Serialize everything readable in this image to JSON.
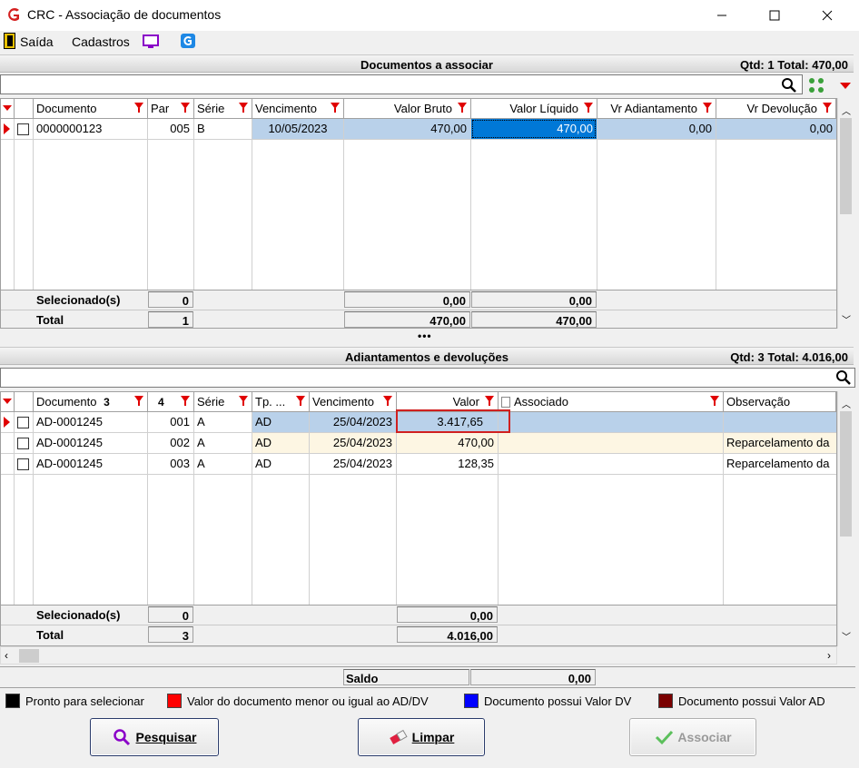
{
  "window": {
    "title": "CRC - Associação de documentos"
  },
  "menu": {
    "saida": "Saída",
    "cadastros": "Cadastros"
  },
  "top_section": {
    "title": "Documentos a associar",
    "summary": "Qtd: 1 Total: 470,00",
    "columns": [
      "Documento",
      "Par",
      "Série",
      "Vencimento",
      "Valor Bruto",
      "Valor Líquido",
      "Vr Adiantamento",
      "Vr Devolução"
    ],
    "rows": [
      {
        "documento": "0000000123",
        "par": "005",
        "serie": "B",
        "vencimento": "10/05/2023",
        "valor_bruto": "470,00",
        "valor_liquido": "470,00",
        "vr_adiantamento": "0,00",
        "vr_devolucao": "0,00"
      }
    ],
    "selecionados_label": "Selecionado(s)",
    "selecionados_count": "0",
    "selecionados_bruto": "0,00",
    "selecionados_liquido": "0,00",
    "total_label": "Total",
    "total_count": "1",
    "total_bruto": "470,00",
    "total_liquido": "470,00"
  },
  "splitter": "•••",
  "bottom_section": {
    "title": "Adiantamentos e devoluções",
    "summary": "Qtd: 3 Total: 4.016,00",
    "columns": [
      "Documento",
      "Par",
      "Série",
      "Tp. ...",
      "Vencimento",
      "Valor",
      "Associado",
      "Observação"
    ],
    "sort_documento": "3",
    "sort_par": "4",
    "rows": [
      {
        "documento": "AD-0001245",
        "par": "001",
        "serie": "A",
        "tp": "AD",
        "vencimento": "25/04/2023",
        "valor": "3.417,65",
        "associado": "",
        "observacao": ""
      },
      {
        "documento": "AD-0001245",
        "par": "002",
        "serie": "A",
        "tp": "AD",
        "vencimento": "25/04/2023",
        "valor": "470,00",
        "associado": "",
        "observacao": "Reparcelamento da"
      },
      {
        "documento": "AD-0001245",
        "par": "003",
        "serie": "A",
        "tp": "AD",
        "vencimento": "25/04/2023",
        "valor": "128,35",
        "associado": "",
        "observacao": "Reparcelamento da"
      }
    ],
    "selecionados_label": "Selecionado(s)",
    "selecionados_count": "0",
    "selecionados_valor": "0,00",
    "total_label": "Total",
    "total_count": "3",
    "total_valor": "4.016,00"
  },
  "saldo": {
    "label": "Saldo",
    "value": "0,00"
  },
  "legend": [
    {
      "color": "#000000",
      "label": "Pronto para selecionar"
    },
    {
      "color": "#ff0000",
      "label": "Valor do documento menor ou igual ao AD/DV"
    },
    {
      "color": "#0000ff",
      "label": "Documento possui Valor DV"
    },
    {
      "color": "#7a0000",
      "label": "Documento possui Valor AD"
    }
  ],
  "buttons": {
    "pesquisar": "Pesquisar",
    "limpar": "Limpar",
    "associar": "Associar"
  },
  "colors": {
    "selected_row": "#b9d1ea",
    "active_cell": "#0078d7",
    "filter_red": "#e00000",
    "highlight_border": "#d02020"
  }
}
